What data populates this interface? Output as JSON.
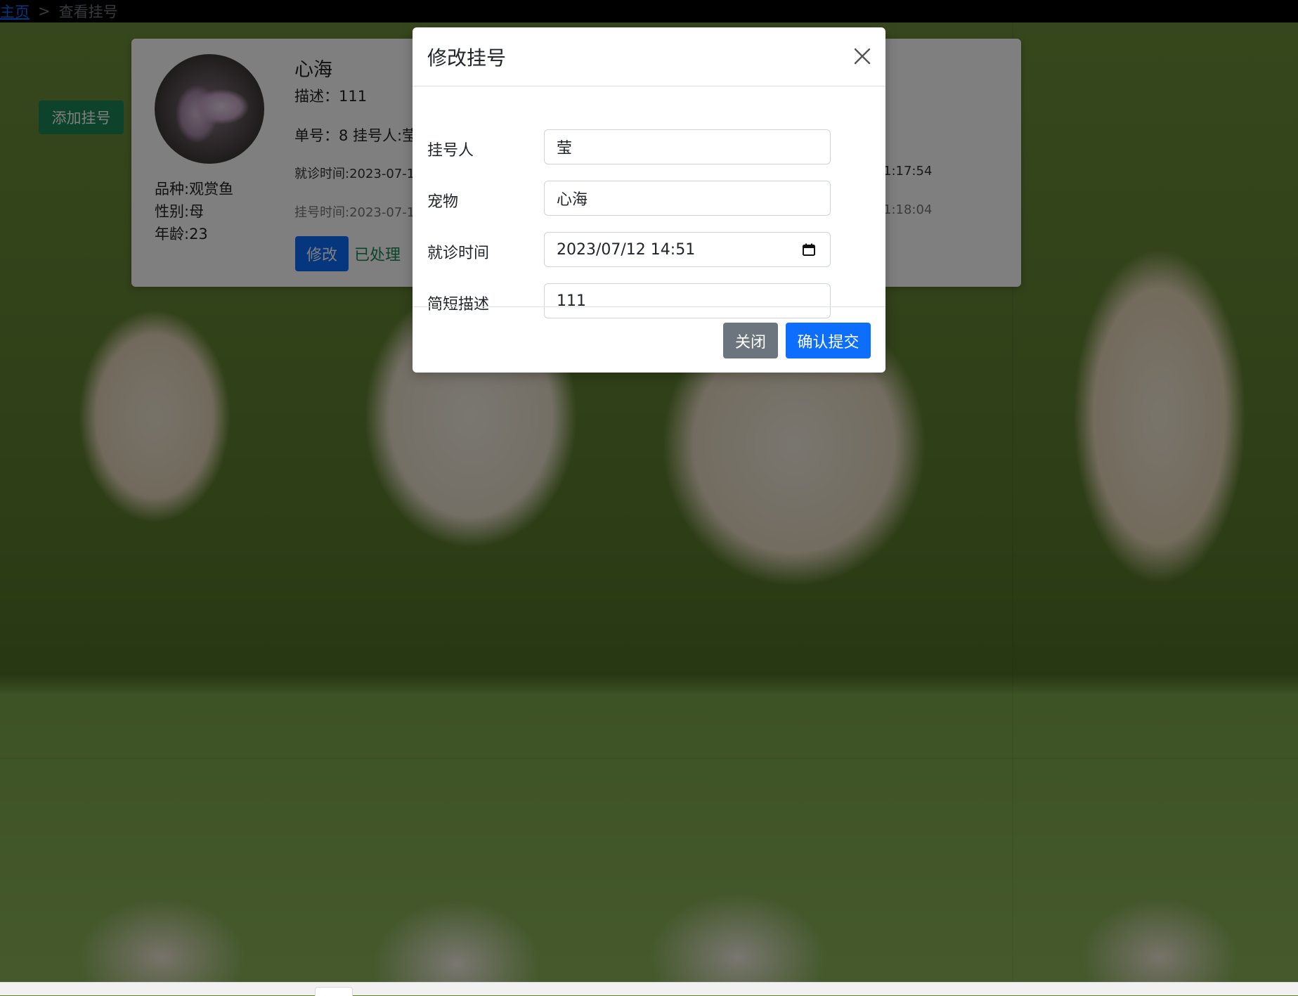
{
  "breadcrumb": {
    "home": "主页",
    "separator": ">",
    "current": "查看挂号"
  },
  "actions": {
    "add_label": "添加挂号"
  },
  "card": {
    "pet_name": "心海",
    "description": "描述：111",
    "order_line": "单号：8  挂号人:莹",
    "visit_time": "就诊时间:2023-07-1",
    "visit_time_tail": "1:17:54",
    "register_time": "挂号时间:2023-07-1",
    "register_time_tail": "1:18:04",
    "breed": "品种:观赏鱼",
    "gender": "性别:母",
    "age": "年龄:23",
    "edit_label": "修改",
    "status_label": "已处理"
  },
  "modal": {
    "title": "修改挂号",
    "fields": [
      {
        "label": "挂号人",
        "value": "莹"
      },
      {
        "label": "宠物",
        "value": "心海"
      },
      {
        "label": "就诊时间",
        "value": "2023/07/12 14:51"
      },
      {
        "label": "简短描述",
        "value": "111"
      }
    ],
    "close_label": "关闭",
    "submit_label": "确认提交"
  },
  "colors": {
    "primary": "#0d6efd",
    "success": "#198754",
    "secondary": "#6c757d",
    "topbar": "#000000"
  },
  "icons": {
    "close": "close-icon",
    "calendar": "calendar-icon"
  }
}
